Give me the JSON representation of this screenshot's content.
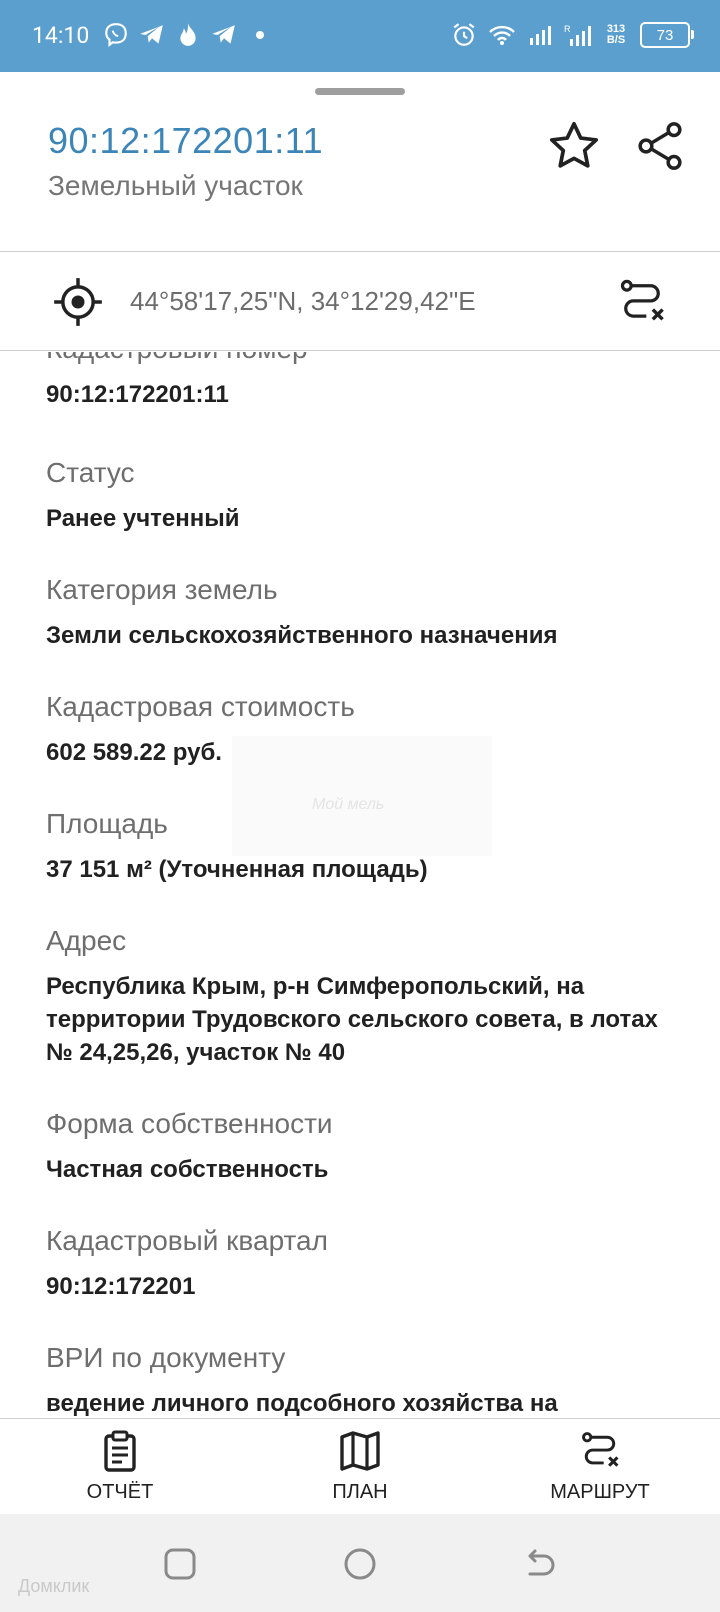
{
  "status_bar": {
    "time": "14:10",
    "speed_top": "313",
    "speed_bottom": "B/S",
    "battery": "73"
  },
  "header": {
    "cadastral_title": "90:12:172201:11",
    "subtitle": "Земельный участок"
  },
  "coordinates": {
    "text": "44°58'17,25\"N, 34°12'29,42\"E"
  },
  "fields": [
    {
      "label": "Кадастровый номер",
      "value": "90:12:172201:11"
    },
    {
      "label": "Статус",
      "value": "Ранее учтенный"
    },
    {
      "label": "Категория земель",
      "value": "Земли сельскохозяйственного назначения"
    },
    {
      "label": "Кадастровая стоимость",
      "value": "602 589.22 руб."
    },
    {
      "label": "Площадь",
      "value": "37 151 м² (Уточненная площадь)"
    },
    {
      "label": "Адрес",
      "value": "Республика Крым, р-н Симферопольский, на территории Трудовского сельского совета, в лотах № 24,25,26, участок № 40"
    },
    {
      "label": "Форма собственности",
      "value": "Частная собственность"
    },
    {
      "label": "Кадастровый квартал",
      "value": "90:12:172201"
    },
    {
      "label": "ВРИ по документу",
      "value": "ведение личного подсобного хозяйства на"
    }
  ],
  "bottom_bar": {
    "report": "ОТЧЁТ",
    "plan": "ПЛАН",
    "route": "МАРШРУТ"
  },
  "watermarks": {
    "center": "Мой мель",
    "corner": "Домклик"
  },
  "colors": {
    "status_bar": "#5b9fcf",
    "accent": "#3c85b8"
  }
}
